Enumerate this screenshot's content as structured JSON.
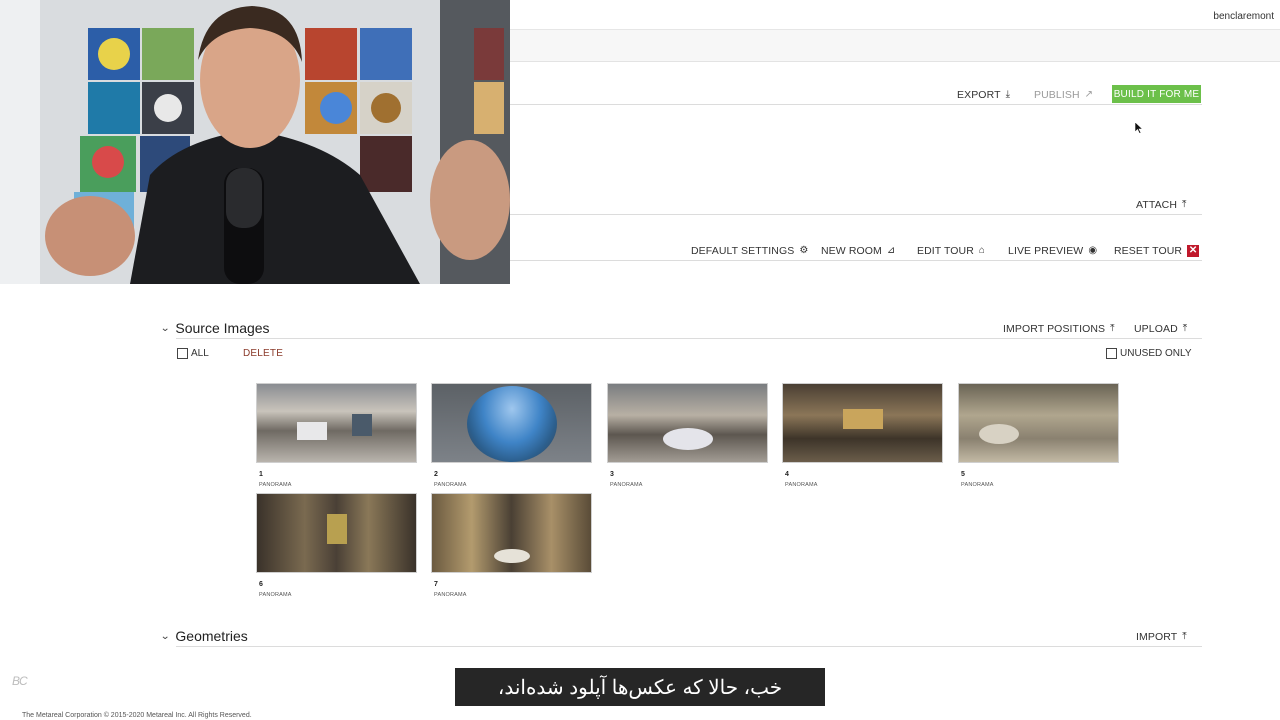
{
  "header": {
    "username": "benclaremont"
  },
  "toolbar": {
    "export_label": "EXPORT",
    "publish_label": "PUBLISH",
    "build_label": "BUILD IT FOR ME",
    "attach_label": "ATTACH"
  },
  "tour_actions": {
    "default_settings": "DEFAULT SETTINGS",
    "new_room": "NEW ROOM",
    "edit_tour": "EDIT TOUR",
    "live_preview": "LIVE PREVIEW",
    "reset_tour": "RESET TOUR"
  },
  "source_images": {
    "title": "Source Images",
    "import_positions": "IMPORT POSITIONS",
    "upload": "UPLOAD",
    "all_label": "ALL",
    "delete_label": "DELETE",
    "unused_only_label": "UNUSED ONLY",
    "images": [
      {
        "number": "1",
        "type": "PANORAMA"
      },
      {
        "number": "2",
        "type": "PANORAMA"
      },
      {
        "number": "3",
        "type": "PANORAMA"
      },
      {
        "number": "4",
        "type": "PANORAMA"
      },
      {
        "number": "5",
        "type": "PANORAMA"
      },
      {
        "number": "6",
        "type": "PANORAMA"
      },
      {
        "number": "7",
        "type": "PANORAMA"
      }
    ]
  },
  "geometries": {
    "title": "Geometries",
    "import": "IMPORT"
  },
  "subtitle": "خب، حالا که عکس‌ها آپلود شده‌اند،",
  "footer": {
    "logo": "BC",
    "copyright": "The Metareal Corporation © 2015-2020 Metareal Inc. All Rights Reserved."
  },
  "colors": {
    "build_button": "#6cc04a",
    "reset_icon": "#c0182b",
    "delete_text": "#8a3a2a"
  }
}
